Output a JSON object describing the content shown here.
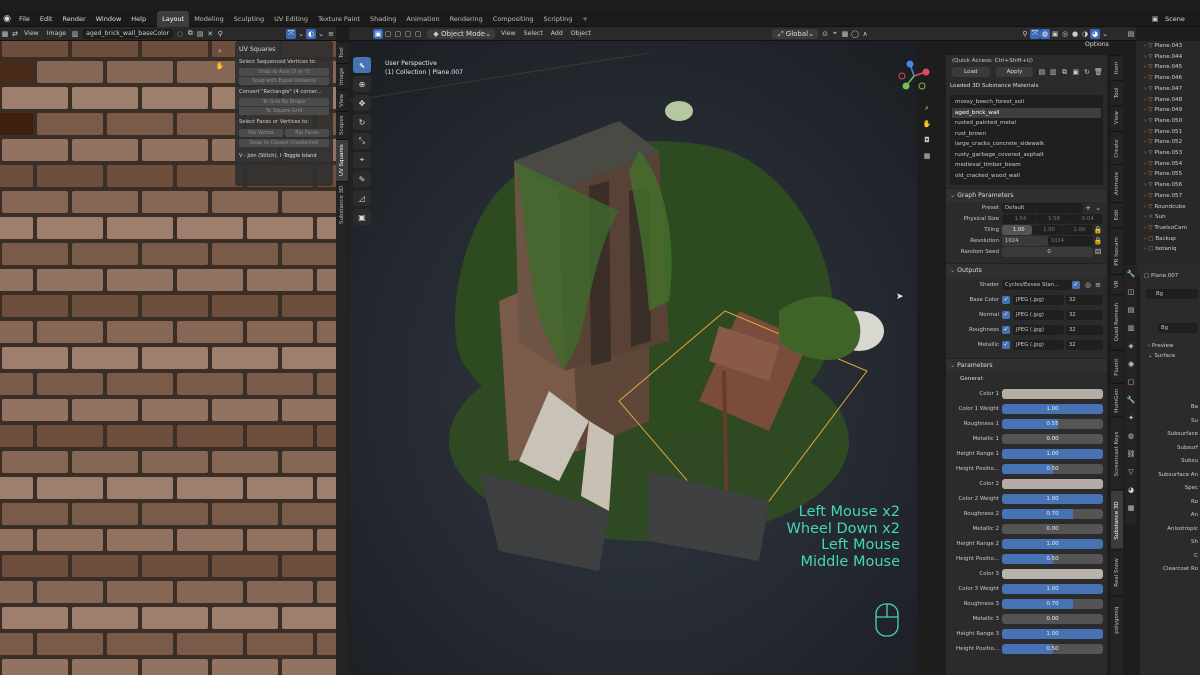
{
  "menubar": {
    "items": [
      "File",
      "Edit",
      "Render",
      "Window",
      "Help"
    ],
    "workspaces": [
      "Layout",
      "Modeling",
      "Sculpting",
      "UV Editing",
      "Texture Paint",
      "Shading",
      "Animation",
      "Rendering",
      "Compositing",
      "Scripting"
    ],
    "active_workspace": "Layout",
    "add_tab": "+",
    "scene": "Scene"
  },
  "image_editor": {
    "view": "View",
    "image": "Image",
    "image_name": "aged_brick_wall_baseColor"
  },
  "uv_panel": {
    "title": "UV Squares",
    "section1": "Select Sequenced Vertices to:",
    "btn_snap_axis": "Snap to Axis (X or Y)",
    "btn_snap_equal": "Snap with Equal Distance",
    "section2": "Convert \"Rectangle\" (4 corner...",
    "btn_grid_shape": "To Grid By Shape",
    "btn_square_grid": "To Square Grid",
    "section3": "Select Faces or Vertices to:",
    "btn_rip_vertex": "Rip Vertex",
    "btn_rip_faces": "Rip Faces",
    "btn_snap_closest": "Snap to Closest Unselected",
    "footer": "V - Join (Stitch), I -Toggle Island"
  },
  "uv_side_tabs": [
    "Tool",
    "Image",
    "View",
    "Scopes",
    "UV Squares",
    "Substance 3D"
  ],
  "viewport_header": {
    "mode": "Object Mode",
    "view": "View",
    "select": "Select",
    "add": "Add",
    "object": "Object",
    "orientation": "Global",
    "options": "Options"
  },
  "viewport": {
    "perspective": "User Perspective",
    "collection": "(1) Collection | Plane.007"
  },
  "keystrokes": [
    "Left Mouse x2",
    "Wheel Down x2",
    "Left Mouse",
    "Middle Mouse"
  ],
  "substance": {
    "quick_access": "(Quick Access: Ctrl+Shift+U)",
    "load": "Load",
    "apply": "Apply",
    "loaded_title": "Loaded 3D Substance Materials",
    "materials": [
      "mossy_beech_forest_soil",
      "aged_brick_wall",
      "rusted_painted_metal",
      "rust_brown",
      "large_cracks_concrete_sidewalk",
      "rusty_garbage_covered_asphalt",
      "medieval_timber_beam",
      "old_cracked_wood_wall"
    ],
    "selected_material": "aged_brick_wall",
    "graph_title": "Graph Parameters",
    "preset_label": "Preset",
    "preset_value": "Default",
    "physical_size_label": "Physical Size",
    "physical_size": [
      "1.54",
      "1.58",
      "0.04"
    ],
    "tiling_label": "Tiling",
    "tiling": [
      "1.00",
      "1.00",
      "1.00"
    ],
    "resolution_label": "Resolution",
    "resolution": [
      "1024",
      "1024"
    ],
    "seed_label": "Random Seed",
    "seed_value": "0",
    "outputs_title": "Outputs",
    "shader_label": "Shader",
    "shader_value": "Cycles/Eevee Stan...",
    "outputs": [
      {
        "label": "Base Color",
        "format": "JPEG (.jpg)",
        "bits": "32"
      },
      {
        "label": "Normal",
        "format": "JPEG (.jpg)",
        "bits": "32"
      },
      {
        "label": "Roughness",
        "format": "JPEG (.jpg)",
        "bits": "32"
      },
      {
        "label": "Metallic",
        "format": "JPEG (.jpg)",
        "bits": "32"
      }
    ],
    "params_title": "Parameters",
    "general": "General:",
    "params": [
      {
        "label": "Color 1",
        "kind": "color",
        "color": "#b5aca4"
      },
      {
        "label": "Color 1 Weight",
        "kind": "slider",
        "value": "1.00",
        "fraction": 1.0
      },
      {
        "label": "Roughness 1",
        "kind": "slider",
        "value": "0.55",
        "fraction": 0.55
      },
      {
        "label": "Metallic 1",
        "kind": "slider",
        "value": "0.00",
        "fraction": 0.0
      },
      {
        "label": "Height Range 1",
        "kind": "slider",
        "value": "1.00",
        "fraction": 1.0
      },
      {
        "label": "Height Positio...",
        "kind": "slider",
        "value": "0.50",
        "fraction": 0.5
      },
      {
        "label": "Color 2",
        "kind": "color",
        "color": "#b3aca6"
      },
      {
        "label": "Color 2 Weight",
        "kind": "slider",
        "value": "1.00",
        "fraction": 1.0
      },
      {
        "label": "Roughness 2",
        "kind": "slider",
        "value": "0.70",
        "fraction": 0.7
      },
      {
        "label": "Metallic 2",
        "kind": "slider",
        "value": "0.00",
        "fraction": 0.0
      },
      {
        "label": "Height Range 2",
        "kind": "slider",
        "value": "1.00",
        "fraction": 1.0
      },
      {
        "label": "Height Positio...",
        "kind": "slider",
        "value": "0.50",
        "fraction": 0.5
      },
      {
        "label": "Color 3",
        "kind": "color",
        "color": "#b8b2ac"
      },
      {
        "label": "Color 3 Weight",
        "kind": "slider",
        "value": "1.00",
        "fraction": 1.0
      },
      {
        "label": "Roughness 3",
        "kind": "slider",
        "value": "0.70",
        "fraction": 0.7
      },
      {
        "label": "Metallic 3",
        "kind": "slider",
        "value": "0.00",
        "fraction": 0.0
      },
      {
        "label": "Height Range 3",
        "kind": "slider",
        "value": "1.00",
        "fraction": 1.0
      },
      {
        "label": "Height Positio...",
        "kind": "slider",
        "value": "0.50",
        "fraction": 0.5
      }
    ]
  },
  "n_panel_tabs": [
    "Item",
    "Tool",
    "View",
    "Create",
    "Animate",
    "Edit",
    "PR Isocam",
    "VR",
    "Quad Remesh",
    "Fluent",
    "HumGen",
    "Screencast Keys",
    "Substance 3D",
    "Real Snow",
    "polygoniq"
  ],
  "outliner": {
    "items": [
      "Plane.043",
      "Plane.044",
      "Plane.045",
      "Plane.046",
      "Plane.047",
      "Plane.048",
      "Plane.049",
      "Plane.050",
      "Plane.051",
      "Plane.052",
      "Plane.053",
      "Plane.054",
      "Plane.055",
      "Plane.056",
      "Plane.057",
      "Roundcube",
      "Sun",
      "TruelsoCam",
      "Backup",
      "botaniq"
    ]
  },
  "properties": {
    "object": "Plane.007",
    "material": "Bg",
    "world": "Bg",
    "preview": "Preview",
    "surface": "Surface",
    "labels": [
      "Ba",
      "Su",
      "Subsurface",
      "Subsurf",
      "Subsu",
      "Subsurface An",
      "Spec",
      "Ro",
      "An",
      "Anisotropic",
      "Sh",
      "C",
      "Clearcoat Ro"
    ]
  }
}
